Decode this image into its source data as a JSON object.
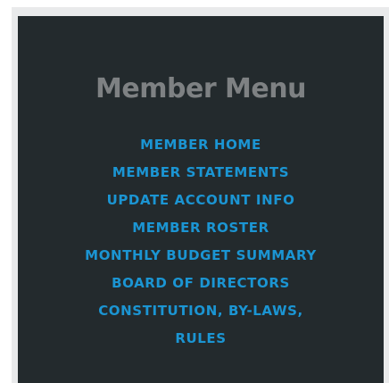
{
  "menu": {
    "title": "Member Menu",
    "items": [
      {
        "label": "MEMBER HOME"
      },
      {
        "label": "MEMBER STATEMENTS"
      },
      {
        "label": "UPDATE ACCOUNT INFO"
      },
      {
        "label": "MEMBER ROSTER"
      },
      {
        "label": "MONTHLY BUDGET SUMMARY"
      },
      {
        "label": "BOARD OF DIRECTORS"
      },
      {
        "label": "CONSTITUTION, BY-LAWS, RULES"
      }
    ]
  },
  "colors": {
    "panel_background": "#232a2d",
    "title_color": "#7e8183",
    "link_color": "#1b95d3"
  }
}
